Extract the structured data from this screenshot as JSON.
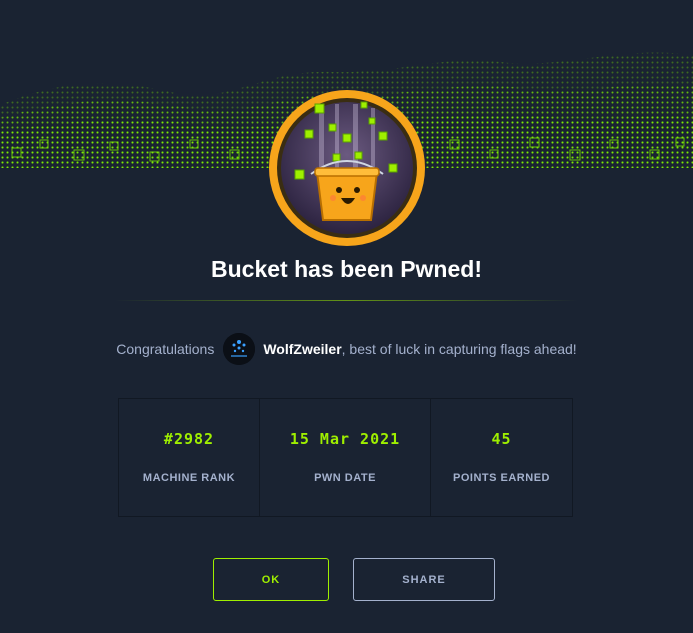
{
  "title": "Bucket has been Pwned!",
  "congrats": {
    "prefix": "Congratulations",
    "username": "WolfZweiler",
    "suffix": ", best of luck in capturing flags ahead!"
  },
  "stats": [
    {
      "value": "#2982",
      "label": "MACHINE RANK"
    },
    {
      "value": "15 Mar 2021",
      "label": "PWN DATE"
    },
    {
      "value": "45",
      "label": "POINTS EARNED"
    }
  ],
  "buttons": {
    "ok": "OK",
    "share": "SHARE"
  },
  "colors": {
    "background": "#1a2332",
    "accent": "#9fef00",
    "muted": "#a4b1cd",
    "badge_ring": "#f7a51b"
  }
}
